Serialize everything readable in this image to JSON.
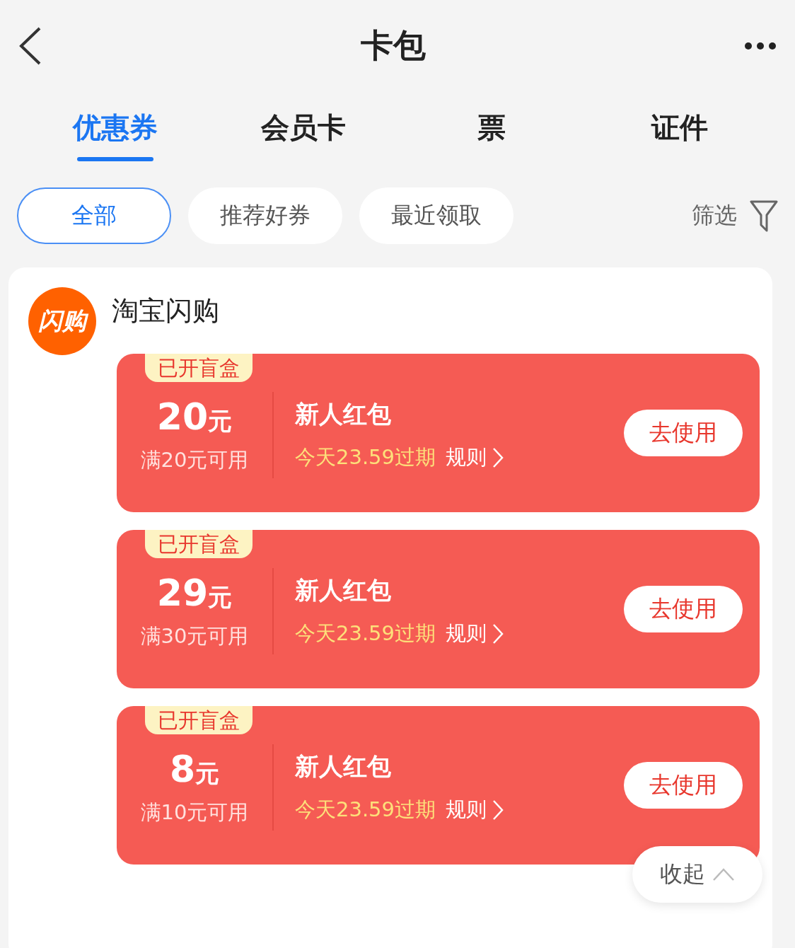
{
  "header": {
    "title": "卡包"
  },
  "tabs": [
    {
      "label": "优惠券",
      "selected": true
    },
    {
      "label": "会员卡",
      "selected": false
    },
    {
      "label": "票",
      "selected": false
    },
    {
      "label": "证件",
      "selected": false
    }
  ],
  "chips": [
    {
      "label": "全部",
      "selected": true
    },
    {
      "label": "推荐好券",
      "selected": false
    },
    {
      "label": "最近领取",
      "selected": false
    }
  ],
  "filter": {
    "label": "筛选"
  },
  "store": {
    "logo_text": "闪购",
    "name": "淘宝闪购",
    "coupons": [
      {
        "tag": "已开盲盒",
        "amount": "20",
        "unit": "元",
        "condition": "满20元可用",
        "title": "新人红包",
        "expiry": "今天23.59过期",
        "rules": "规则",
        "action": "去使用"
      },
      {
        "tag": "已开盲盒",
        "amount": "29",
        "unit": "元",
        "condition": "满30元可用",
        "title": "新人红包",
        "expiry": "今天23.59过期",
        "rules": "规则",
        "action": "去使用"
      },
      {
        "tag": "已开盲盒",
        "amount": "8",
        "unit": "元",
        "condition": "满10元可用",
        "title": "新人红包",
        "expiry": "今天23.59过期",
        "rules": "规则",
        "action": "去使用"
      }
    ],
    "collapse": "收起"
  }
}
